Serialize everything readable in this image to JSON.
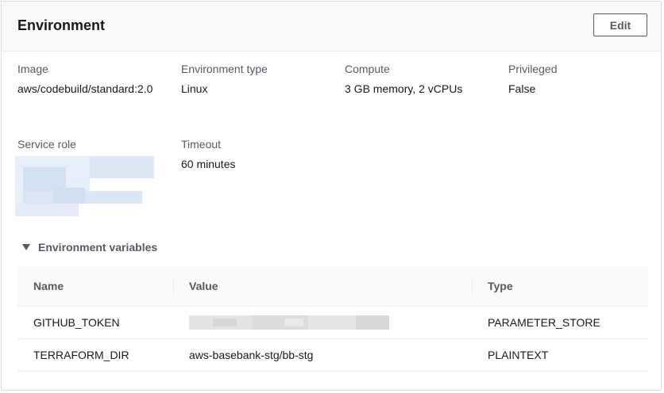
{
  "panel": {
    "title": "Environment",
    "edit_label": "Edit"
  },
  "fields": {
    "image": {
      "label": "Image",
      "value": "aws/codebuild/standard:2.0"
    },
    "environment_type": {
      "label": "Environment type",
      "value": "Linux"
    },
    "compute": {
      "label": "Compute",
      "value": "3 GB memory, 2 vCPUs"
    },
    "privileged": {
      "label": "Privileged",
      "value": "False"
    },
    "service_role": {
      "label": "Service role"
    },
    "timeout": {
      "label": "Timeout",
      "value": "60 minutes"
    }
  },
  "env_vars": {
    "section_label": "Environment variables",
    "columns": [
      "Name",
      "Value",
      "Type"
    ],
    "rows": [
      {
        "name": "GITHUB_TOKEN",
        "value": "",
        "type": "PARAMETER_STORE"
      },
      {
        "name": "TERRAFORM_DIR",
        "value": "aws-basebank-stg/bb-stg",
        "type": "PLAINTEXT"
      }
    ]
  },
  "colors": {
    "border": "#d5dbdb",
    "label": "#545b64",
    "text": "#16191f",
    "header_bg": "#fafafa",
    "redaction_blue": "#dbe7f5",
    "redaction_gray": "#e1e1e1"
  }
}
